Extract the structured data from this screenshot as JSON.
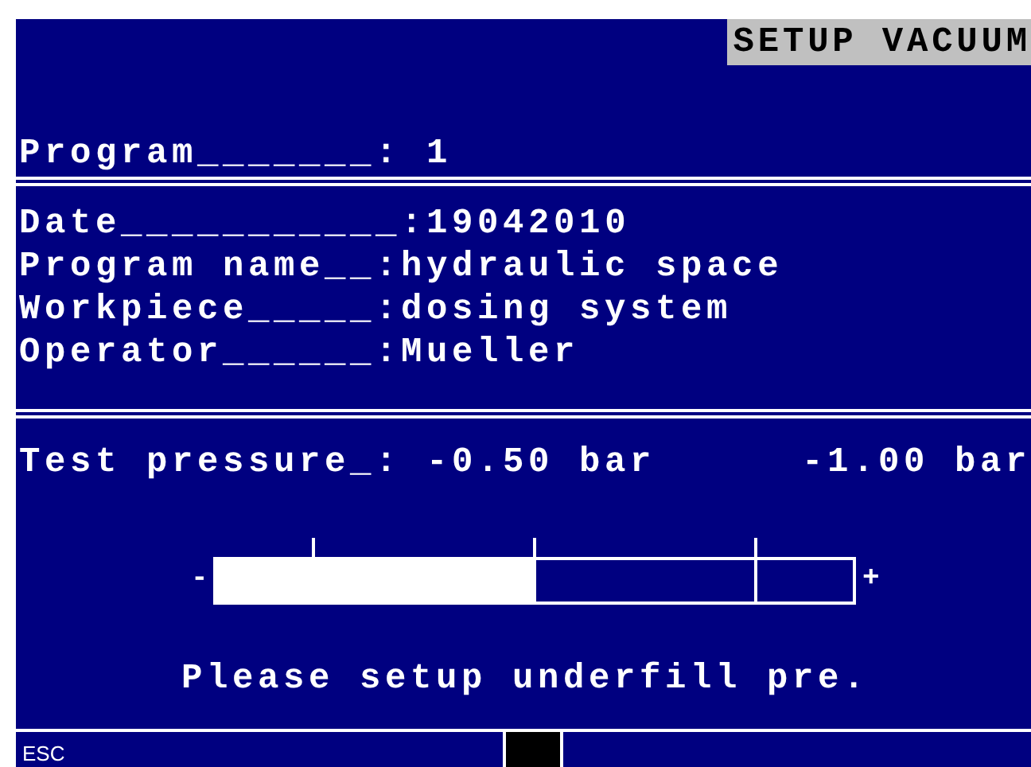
{
  "title": "SETUP VACUUM",
  "program": {
    "label": "Program_______",
    "value": ": 1"
  },
  "fields": [
    {
      "label": "Date___________",
      "value": ":19042010"
    },
    {
      "label": "Program name__",
      "value": ":hydraulic space"
    },
    {
      "label": "Workpiece_____",
      "value": ":dosing system"
    },
    {
      "label": "Operator______",
      "value": ":Mueller"
    }
  ],
  "pressure": {
    "label": "Test pressure_",
    "value": ": -0.50 bar",
    "limit": "-1.00 bar",
    "minus": "-",
    "plus": "+",
    "level": 0.5
  },
  "message": "Please setup underfill pre.",
  "footer": {
    "key": "ESC"
  }
}
